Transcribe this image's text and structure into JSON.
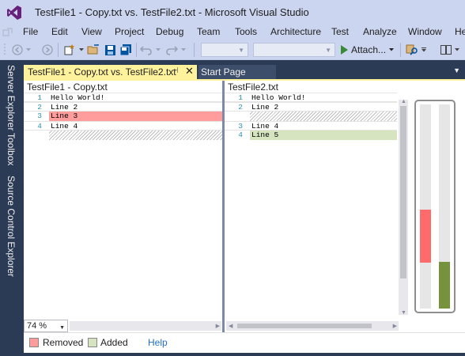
{
  "window": {
    "title": "TestFile1 - Copy.txt vs. TestFile2.txt - Microsoft Visual Studio",
    "logo_icon": "visual-studio-logo"
  },
  "menu": [
    "File",
    "Edit",
    "View",
    "Project",
    "Debug",
    "Team",
    "Tools",
    "Architecture",
    "Test",
    "Analyze",
    "Window",
    "He"
  ],
  "toolbar": {
    "attach_label": "Attach...",
    "icons": [
      "back-icon",
      "forward-icon",
      "new-project-icon",
      "open-file-icon",
      "save-icon",
      "save-all-icon",
      "undo-icon",
      "redo-icon",
      "start-icon",
      "find-icon",
      "layout-icon"
    ]
  },
  "side_tabs": [
    "Server Explorer",
    "Toolbox",
    "Source Control Explorer"
  ],
  "tabs": {
    "active": "TestFile1 - Copy.txt vs. TestFile2.txt",
    "inactive": "Start Page"
  },
  "left_pane": {
    "title": "TestFile1 - Copy.txt",
    "lines": [
      {
        "num": "1",
        "text": "Hello World!",
        "state": "normal"
      },
      {
        "num": "2",
        "text": "Line 2",
        "state": "normal"
      },
      {
        "num": "3",
        "text": "Line 3",
        "state": "removed"
      },
      {
        "num": "4",
        "text": "Line 4",
        "state": "normal"
      },
      {
        "num": "",
        "text": "",
        "state": "placeholder"
      }
    ]
  },
  "right_pane": {
    "title": "TestFile2.txt",
    "lines": [
      {
        "num": "1",
        "text": "Hello World!",
        "state": "normal"
      },
      {
        "num": "2",
        "text": "Line 2",
        "state": "normal"
      },
      {
        "num": "",
        "text": "",
        "state": "placeholder"
      },
      {
        "num": "3",
        "text": "Line 4",
        "state": "normal"
      },
      {
        "num": "4",
        "text": "Line 5",
        "state": "added"
      }
    ]
  },
  "zoom": "74 %",
  "legend": {
    "removed_label": "Removed",
    "added_label": "Added",
    "help_label": "Help"
  },
  "colors": {
    "removed": "#ff9d9d",
    "added": "#d6e5c0",
    "overview_removed": "#ff6b6b",
    "overview_added": "#76923c",
    "tab_active": "#fff29d",
    "chrome": "#ccd5f0"
  }
}
